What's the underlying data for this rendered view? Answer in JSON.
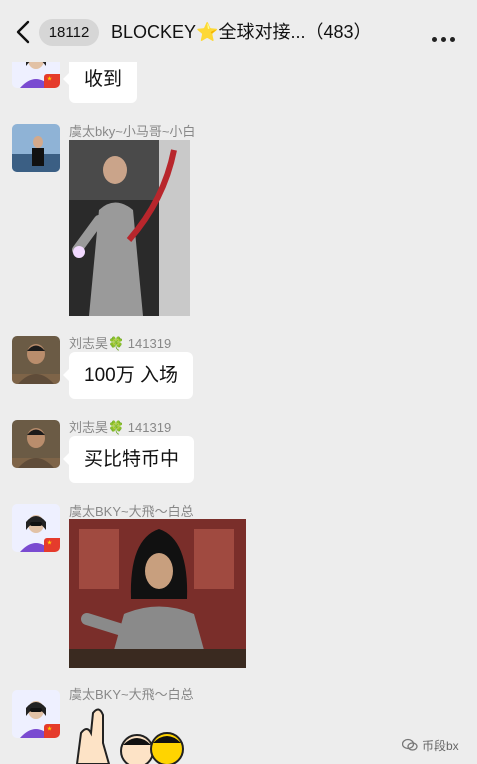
{
  "header": {
    "back_icon": "chevron-left-icon",
    "unread_count": "18112",
    "group_title": "BLOCKEY⭐全球对接...",
    "member_count": "（483）",
    "more_icon": "more-dots-icon"
  },
  "messages": [
    {
      "sender": "",
      "text": "收到"
    },
    {
      "sender": "虞太bky~小马哥~小白",
      "media": "video-thumbnail"
    },
    {
      "sender": "刘志昊🍀 141319",
      "text": "100万 入场"
    },
    {
      "sender": "刘志昊🍀 141319",
      "text": "买比特币中"
    },
    {
      "sender": "虞太BKY~大飛～白总",
      "media": "gif"
    },
    {
      "sender": "虞太BKY~大飛～白总",
      "media": "sticker"
    }
  ],
  "watermark": {
    "icon": "wechat-icon",
    "text": "币段bx"
  },
  "colors": {
    "background": "#ededed",
    "bubble": "#ffffff",
    "flag": "#e53b2c"
  }
}
